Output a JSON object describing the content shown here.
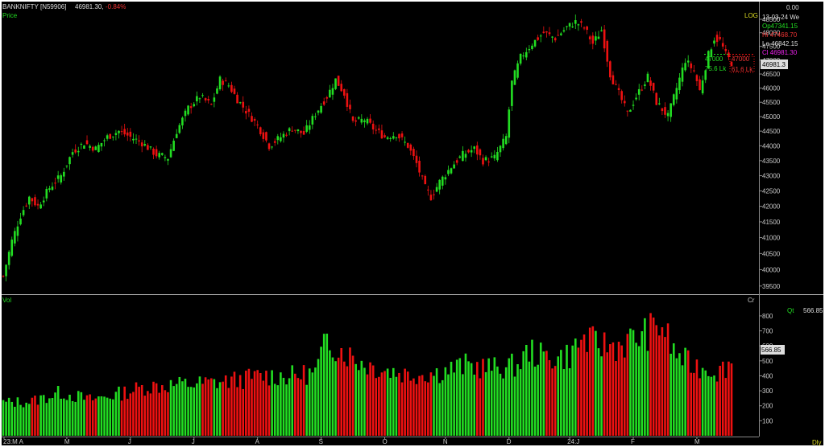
{
  "header": {
    "symbol": "BANKNIFTY [N59906]",
    "last": "46981.30,",
    "change": "-0.84%",
    "price_label": "Price",
    "scale_label": "LOG",
    "vol_label": "Vol",
    "vol_unit": "Cr",
    "period": "Dly"
  },
  "info_panel": {
    "top_value": "0.00",
    "date": "13-03-24 We",
    "open": "Op47341.15",
    "high": "Hi 47468.70",
    "low": "Lo 46842.15",
    "close": "Cl 46981.30",
    "qt_label": "Qt",
    "qt_value": "566.85"
  },
  "annotations": {
    "level_top_left": "47000",
    "level_top_right": "47000",
    "vol_left": "75.6 Lk",
    "vol_right": "61.6 Lk",
    "price_tag": "46981.3",
    "vol_tag": "566.85"
  },
  "colors": {
    "up": "#22dd22",
    "down": "#ee1111",
    "background": "#000000",
    "axis_text": "#cccccc",
    "info_green": "#22dd22",
    "info_red": "#ee3333",
    "info_magenta": "#ee22ee",
    "info_yellow": "#dddd22"
  },
  "chart_data": [
    {
      "type": "candlestick",
      "scale": "log",
      "ylim": [
        39300,
        48800
      ],
      "yticks": [
        39500,
        40000,
        40500,
        41000,
        41500,
        42000,
        42500,
        43000,
        43500,
        44000,
        44500,
        45000,
        45500,
        46000,
        46500,
        47000,
        47500,
        48000,
        48500
      ],
      "x_months": [
        {
          "label": "23:M A",
          "index": 0
        },
        {
          "label": "M",
          "index": 22
        },
        {
          "label": "J",
          "index": 44
        },
        {
          "label": "J",
          "index": 66
        },
        {
          "label": "A",
          "index": 88
        },
        {
          "label": "S",
          "index": 110
        },
        {
          "label": "O",
          "index": 132
        },
        {
          "label": "N",
          "index": 153
        },
        {
          "label": "D",
          "index": 175
        },
        {
          "label": "24:J",
          "index": 196
        },
        {
          "label": "F",
          "index": 218
        },
        {
          "label": "M",
          "index": 240
        }
      ],
      "anchors": [
        [
          0,
          39800
        ],
        [
          3,
          40900
        ],
        [
          6,
          41700
        ],
        [
          9,
          42300
        ],
        [
          12,
          42000
        ],
        [
          16,
          42600
        ],
        [
          20,
          43000
        ],
        [
          24,
          43800
        ],
        [
          28,
          44100
        ],
        [
          32,
          43900
        ],
        [
          36,
          44300
        ],
        [
          40,
          44500
        ],
        [
          44,
          44300
        ],
        [
          48,
          44100
        ],
        [
          53,
          43700
        ],
        [
          57,
          43600
        ],
        [
          60,
          44500
        ],
        [
          64,
          45300
        ],
        [
          68,
          45700
        ],
        [
          72,
          45400
        ],
        [
          75,
          46300
        ],
        [
          78,
          46100
        ],
        [
          81,
          45600
        ],
        [
          84,
          45200
        ],
        [
          88,
          44700
        ],
        [
          92,
          44000
        ],
        [
          96,
          44300
        ],
        [
          100,
          44600
        ],
        [
          104,
          44400
        ],
        [
          108,
          45100
        ],
        [
          112,
          45700
        ],
        [
          115,
          46300
        ],
        [
          118,
          45800
        ],
        [
          121,
          44800
        ],
        [
          125,
          44900
        ],
        [
          128,
          44600
        ],
        [
          132,
          44300
        ],
        [
          136,
          44400
        ],
        [
          140,
          44000
        ],
        [
          143,
          43400
        ],
        [
          146,
          42600
        ],
        [
          148,
          42300
        ],
        [
          151,
          42800
        ],
        [
          155,
          43300
        ],
        [
          159,
          43700
        ],
        [
          163,
          43900
        ],
        [
          166,
          43500
        ],
        [
          170,
          43600
        ],
        [
          174,
          44300
        ],
        [
          176,
          46200
        ],
        [
          179,
          47100
        ],
        [
          183,
          47600
        ],
        [
          187,
          48000
        ],
        [
          191,
          47800
        ],
        [
          195,
          48200
        ],
        [
          198,
          48400
        ],
        [
          201,
          48200
        ],
        [
          204,
          47600
        ],
        [
          207,
          48100
        ],
        [
          210,
          46500
        ],
        [
          213,
          45800
        ],
        [
          216,
          45100
        ],
        [
          219,
          45700
        ],
        [
          223,
          46400
        ],
        [
          226,
          45500
        ],
        [
          230,
          45000
        ],
        [
          233,
          46000
        ],
        [
          236,
          47000
        ],
        [
          239,
          46600
        ],
        [
          241,
          45900
        ],
        [
          244,
          47200
        ],
        [
          246,
          47800
        ],
        [
          248,
          47700
        ],
        [
          250,
          47200
        ],
        [
          252,
          46900
        ]
      ],
      "count": 253
    },
    {
      "type": "bar",
      "name": "Vol",
      "ylim": [
        0,
        880
      ],
      "yticks": [
        100,
        200,
        300,
        400,
        500,
        600,
        700,
        800
      ],
      "anchors": [
        [
          0,
          220
        ],
        [
          10,
          230
        ],
        [
          20,
          290
        ],
        [
          30,
          240
        ],
        [
          40,
          280
        ],
        [
          50,
          330
        ],
        [
          60,
          340
        ],
        [
          70,
          350
        ],
        [
          80,
          370
        ],
        [
          90,
          400
        ],
        [
          100,
          400
        ],
        [
          108,
          420
        ],
        [
          112,
          640
        ],
        [
          118,
          560
        ],
        [
          124,
          490
        ],
        [
          130,
          450
        ],
        [
          140,
          410
        ],
        [
          150,
          420
        ],
        [
          160,
          470
        ],
        [
          170,
          450
        ],
        [
          178,
          470
        ],
        [
          182,
          570
        ],
        [
          186,
          530
        ],
        [
          192,
          520
        ],
        [
          196,
          540
        ],
        [
          200,
          640
        ],
        [
          206,
          610
        ],
        [
          212,
          600
        ],
        [
          218,
          640
        ],
        [
          224,
          700
        ],
        [
          228,
          740
        ],
        [
          232,
          560
        ],
        [
          238,
          470
        ],
        [
          244,
          450
        ],
        [
          248,
          430
        ],
        [
          252,
          500
        ]
      ],
      "count": 253
    }
  ]
}
